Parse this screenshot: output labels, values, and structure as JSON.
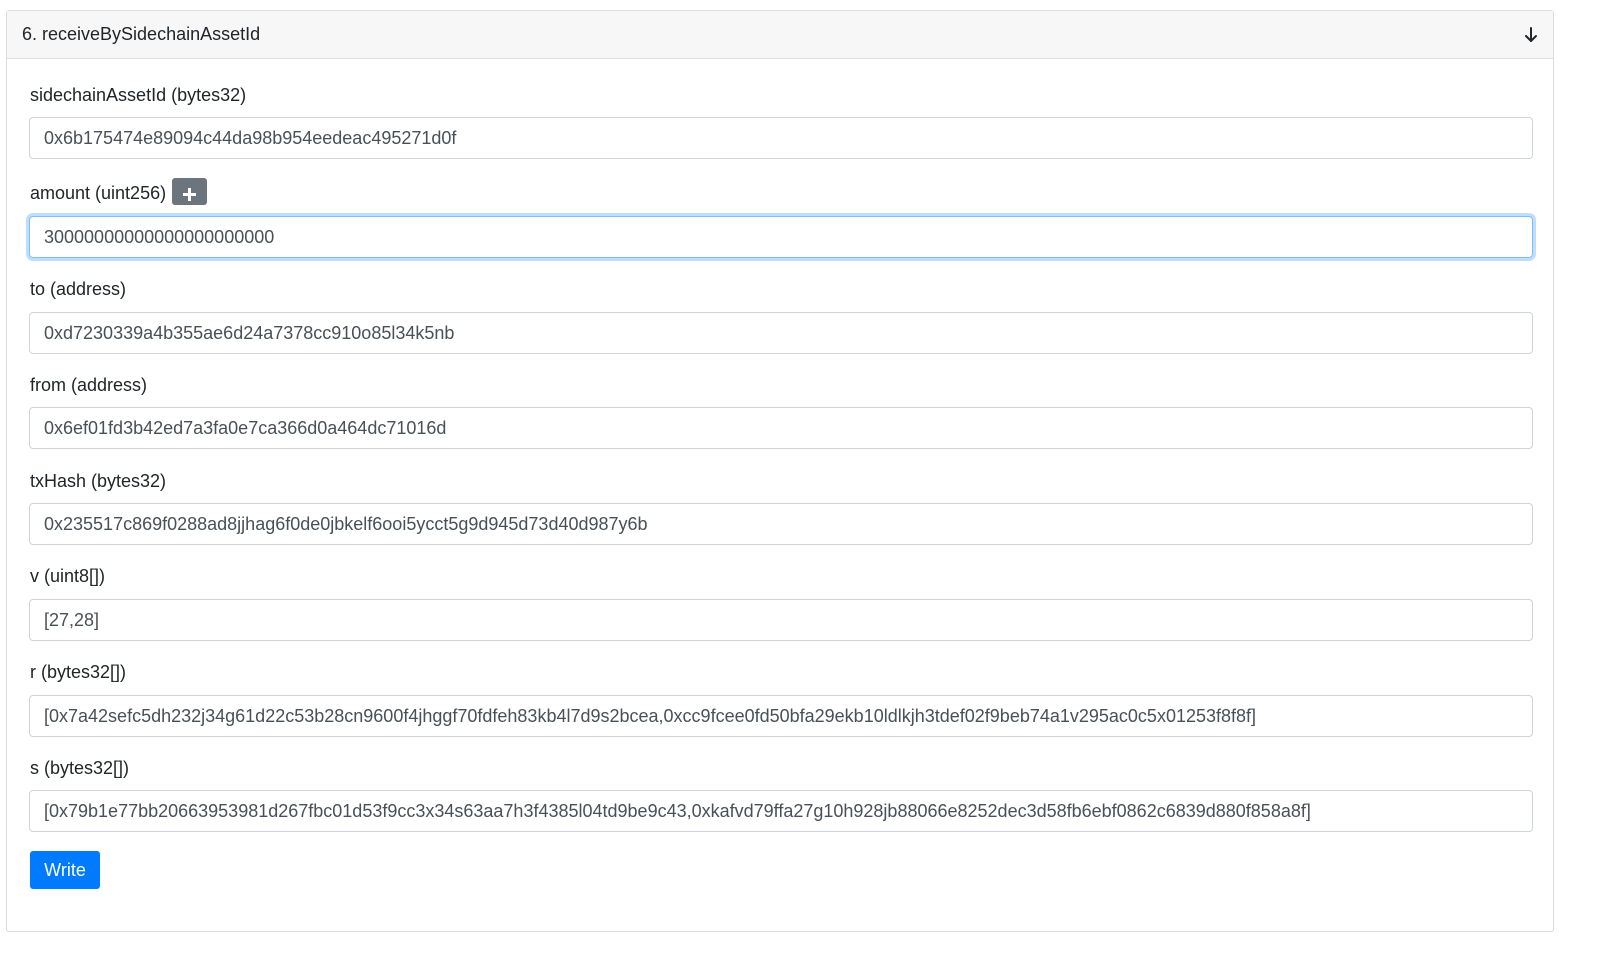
{
  "header": {
    "title": "6. receiveBySidechainAssetId",
    "collapse_icon": "arrow-down-icon"
  },
  "fields": [
    {
      "label": "sidechainAssetId (bytes32)",
      "value": "0x6b175474e89094c44da98b954eedeac495271d0f"
    },
    {
      "label": "amount (uint256)",
      "value": "30000000000000000000000",
      "add_icon": "plus-icon"
    },
    {
      "label": "to (address)",
      "value": "0xd7230339a4b355ae6d24a7378cc910o85l34k5nb"
    },
    {
      "label": "from (address)",
      "value": "0x6ef01fd3b42ed7a3fa0e7ca366d0a464dc71016d"
    },
    {
      "label": "txHash (bytes32)",
      "value": "0x235517c869f0288ad8jjhag6f0de0jbkelf6ooi5ycct5g9d945d73d40d987y6b"
    },
    {
      "label": "v (uint8[])",
      "value": "[27,28]"
    },
    {
      "label": "r (bytes32[])",
      "value": "[0x7a42sefc5dh232j34g61d22c53b28cn9600f4jhggf70fdfeh83kb4l7d9s2bcea,0xcc9fcee0fd50bfa29ekb10ldlkjh3tdef02f9beb74a1v295ac0c5x01253f8f8f]"
    },
    {
      "label": "s (bytes32[])",
      "value": "[0x79b1e77bb20663953981d267fbc01d53f9cc3x34s63aa7h3f4385l04td9be9c43,0xkafvd79ffa27g10h928jb88066e8252dec3d58fb6ebf0862c6839d880f858a8f]"
    }
  ],
  "write_button": {
    "label": "Write"
  },
  "colors": {
    "primary": "#007bff",
    "secondary": "#6c757d",
    "focus_border": "#80bdff",
    "header_bg": "#f7f7f7"
  }
}
